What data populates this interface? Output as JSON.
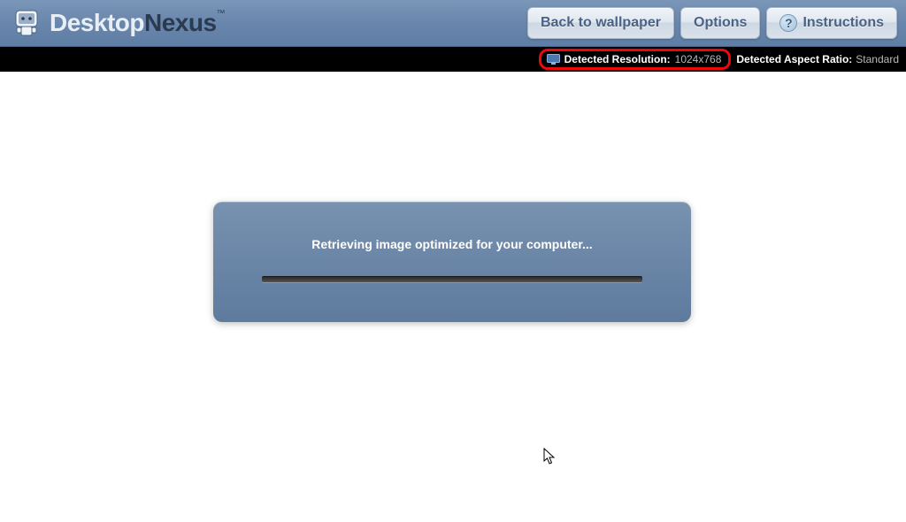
{
  "header": {
    "logo": {
      "name": "Desktop",
      "name2": "Nexus",
      "tm": "™"
    },
    "buttons": {
      "back": "Back to wallpaper",
      "options": "Options",
      "instructions": "Instructions",
      "help_symbol": "?"
    }
  },
  "status_bar": {
    "resolution_label": "Detected Resolution:",
    "resolution_value": "1024x768",
    "aspect_label": "Detected Aspect Ratio:",
    "aspect_value": "Standard"
  },
  "loading": {
    "message": "Retrieving image optimized for your computer..."
  }
}
